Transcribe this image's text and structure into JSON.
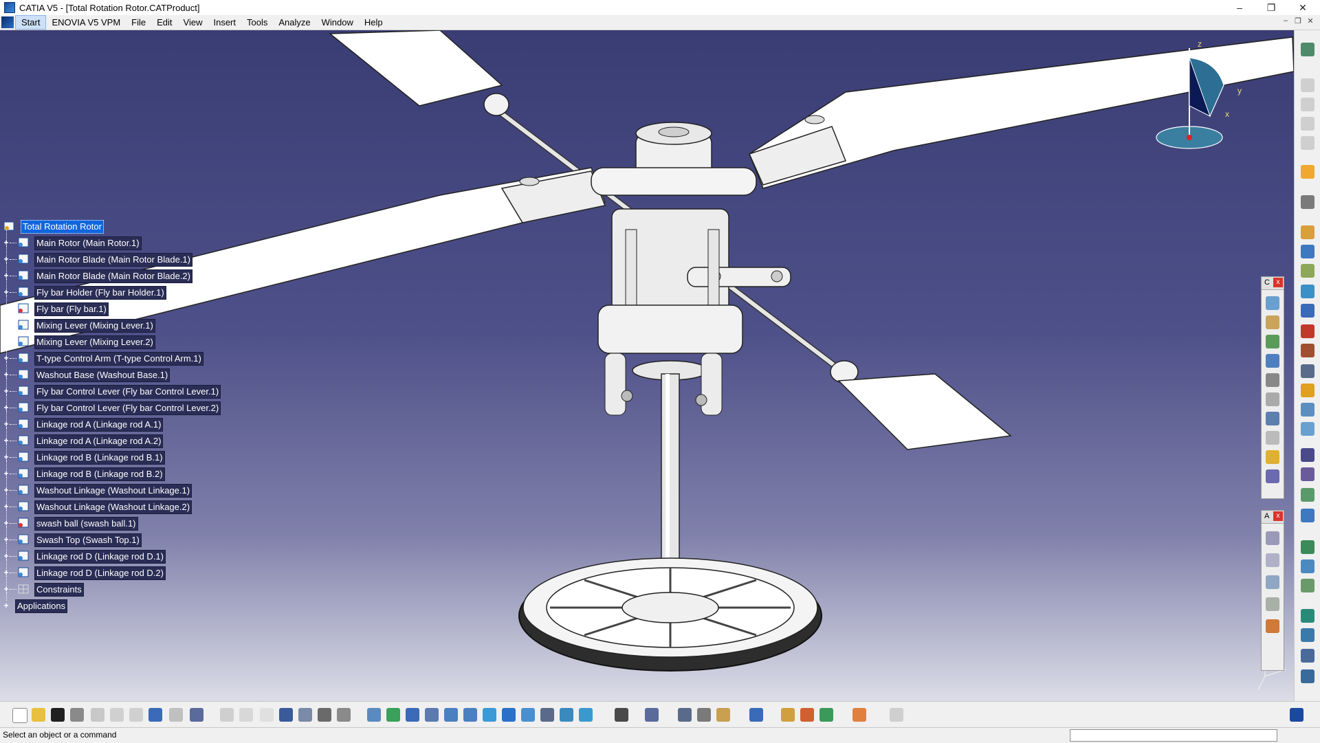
{
  "window": {
    "title": "CATIA V5 - [Total Rotation Rotor.CATProduct]",
    "minimize": "–",
    "maximize": "❐",
    "close": "✕"
  },
  "menu": {
    "items": [
      "Start",
      "ENOVIA V5 VPM",
      "File",
      "Edit",
      "View",
      "Insert",
      "Tools",
      "Analyze",
      "Window",
      "Help"
    ]
  },
  "tree": {
    "root": "Total Rotation Rotor",
    "nodes": [
      "Main Rotor (Main Rotor.1)",
      "Main Rotor Blade (Main Rotor Blade.1)",
      "Main Rotor Blade (Main Rotor Blade.2)",
      "Fly bar Holder (Fly bar Holder.1)",
      "Fly bar (Fly bar.1)",
      "Mixing Lever (Mixing Lever.1)",
      "Mixing Lever (Mixing Lever.2)",
      "T-type Control Arm (T-type Control Arm.1)",
      "Washout Base (Washout Base.1)",
      "Fly bar Control Lever (Fly bar Control Lever.1)",
      "Fly bar Control Lever (Fly bar Control Lever.2)",
      "Linkage rod A (Linkage rod A.1)",
      "Linkage rod A (Linkage rod A.2)",
      "Linkage rod B (Linkage rod B.1)",
      "Linkage rod B (Linkage rod B.2)",
      "Washout Linkage (Washout Linkage.1)",
      "Washout Linkage (Washout Linkage.2)",
      "swash ball (swash ball.1)",
      "Swash Top (Swash Top.1)",
      "Linkage rod D (Linkage rod D.1)",
      "Linkage rod D (Linkage rod D.2)",
      "Constraints",
      "Applications"
    ]
  },
  "compass": {
    "z": "z",
    "y": "y",
    "x": "x"
  },
  "float_toolbar_1": {
    "label": "C",
    "close": "x"
  },
  "float_toolbar_2": {
    "label": "A",
    "close": "x"
  },
  "status": {
    "message": "Select an object or a command"
  },
  "colors": {
    "bg_top": "#3a3d74",
    "bg_bottom": "#dcdde7",
    "tree_selected": "#1166dd",
    "tree_label_bg": "#2a2d55"
  }
}
